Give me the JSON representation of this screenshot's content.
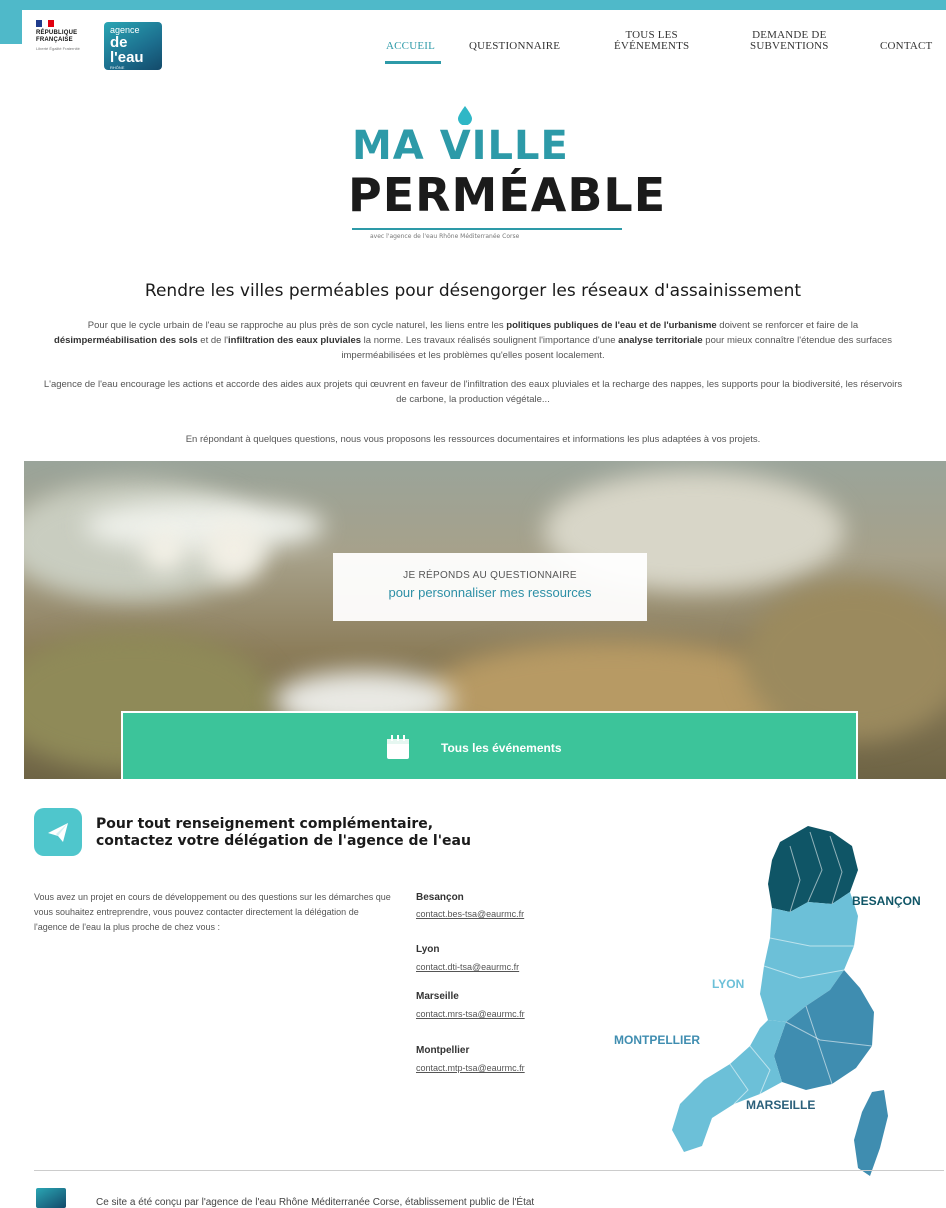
{
  "header": {
    "republique_name": "RÉPUBLIQUE FRANÇAISE",
    "republique_motto": "Liberté Égalité Fraternité",
    "agency_logo_line1": "agence",
    "agency_logo_line2": "de l'eau",
    "agency_logo_line3": "RHÔNE MÉDITERRANÉE CORSE"
  },
  "nav": {
    "items": [
      {
        "label": "ACCUEIL",
        "active": true
      },
      {
        "label": "QUESTIONNAIRE"
      },
      {
        "label": "TOUS LES ÉVÉNEMENTS",
        "line1": "TOUS LES",
        "line2": "ÉVÉNEMENTS"
      },
      {
        "label": "DEMANDE DE SUBVENTIONS",
        "line1": "DEMANDE DE",
        "line2": "SUBVENTIONS"
      },
      {
        "label": "CONTACT"
      }
    ]
  },
  "brand": {
    "line1": "MA VILLE",
    "line2": "PERMÉABLE",
    "tagline": "avec l'agence de l'eau Rhône Méditerranée Corse"
  },
  "intro": {
    "headline": "Rendre les villes perméables pour désengorger les réseaux d'assainissement",
    "p1": [
      {
        "t": "Pour que le cycle urbain de l'eau se rapproche au plus près de son cycle naturel, les liens entre les "
      },
      {
        "t": "politiques publiques de l'eau et de l'urbanisme",
        "b": true
      },
      {
        "t": " doivent se renforcer et faire de la "
      },
      {
        "t": "désimperméabilisation des sols",
        "b": true
      },
      {
        "t": " et de l'"
      },
      {
        "t": "infiltration des eaux pluviales",
        "b": true
      },
      {
        "t": " la norme. Les travaux réalisés soulignent l'importance d'une "
      },
      {
        "t": "analyse territoriale",
        "b": true
      },
      {
        "t": " pour mieux connaître l'étendue des surfaces imperméabilisées et les problèmes qu'elles posent localement."
      }
    ],
    "p2": "L'agence de l'eau encourage les actions et accorde des aides aux projets qui œuvrent en faveur de l'infiltration des eaux pluviales et la recharge des nappes, les supports pour la biodiversité, les réservoirs de carbone, la production végétale...",
    "p3": "En répondant à quelques questions, nous vous proposons les ressources documentaires et informations les plus adaptées à vos projets."
  },
  "hero": {
    "cta_line1": "JE RÉPONDS AU QUESTIONNAIRE",
    "cta_line2": "pour personnaliser mes ressources",
    "events_label": "Tous les événements"
  },
  "contact": {
    "title_line1": "Pour tout renseignement complémentaire,",
    "title_line2": "contactez votre délégation de l'agence de l'eau",
    "intro": "Vous avez un projet en cours de développement ou des questions sur les démarches que vous souhaitez entreprendre, vous pouvez contacter directement la délégation de l'agence de l'eau la plus proche de chez vous :",
    "delegations": [
      {
        "city": "Besançon",
        "email": "contact.bes-tsa@eaurmc.fr"
      },
      {
        "city": "Lyon",
        "email": "contact.dti-tsa@eaurmc.fr"
      },
      {
        "city": "Marseille",
        "email": "contact.mrs-tsa@eaurmc.fr"
      },
      {
        "city": "Montpellier",
        "email": "contact.mtp-tsa@eaurmc.fr"
      }
    ],
    "map_labels": {
      "besancon": "BESANÇON",
      "lyon": "LYON",
      "montpellier": "MONTPELLIER",
      "marseille": "MARSEILLE"
    }
  },
  "footer": {
    "text": "Ce site a été conçu par l'agence de l'eau Rhône Méditerranée Corse, établissement public de l'État"
  },
  "colors": {
    "accent": "#2d9aa8",
    "events_green": "#3cc49a",
    "map_dark": "#0f5566",
    "map_light": "#6cc0d8",
    "map_mid": "#3f8db0"
  }
}
